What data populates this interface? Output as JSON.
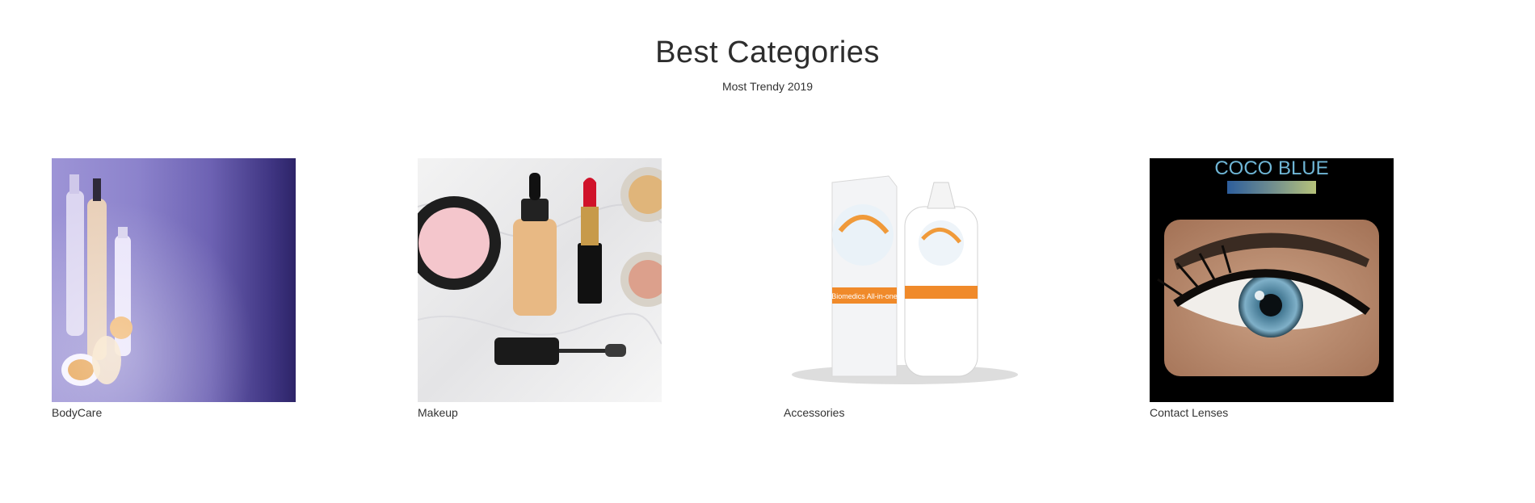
{
  "section": {
    "title": "Best Categories",
    "subtitle": "Most Trendy 2019"
  },
  "categories": [
    {
      "label": "BodyCare",
      "icon": "bodycare-products-image"
    },
    {
      "label": "Makeup",
      "icon": "makeup-products-image"
    },
    {
      "label": "Accessories",
      "icon": "lens-solution-image"
    },
    {
      "label": "Contact Lenses",
      "icon": "contact-lens-eye-image"
    }
  ],
  "lenses_image": {
    "brand_text": "COCO BLUE"
  },
  "accessories_image": {
    "product_text": "Biomedics All-in-one"
  }
}
